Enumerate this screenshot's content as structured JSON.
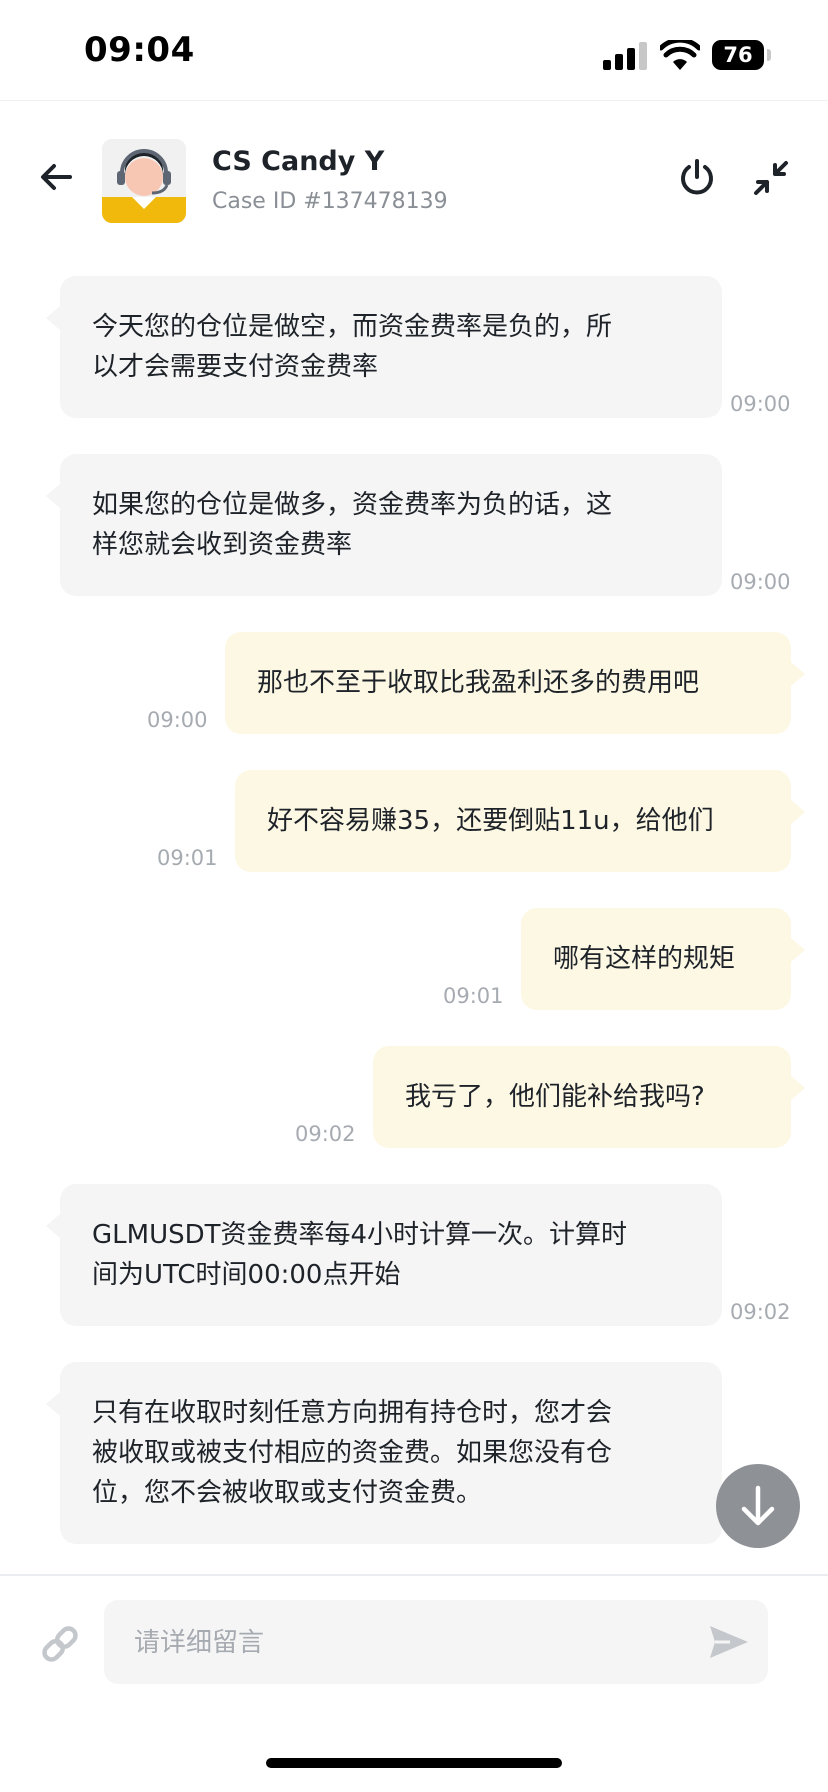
{
  "status_bar": {
    "time": "09:04",
    "battery": "76"
  },
  "header": {
    "agent_name": "CS Candy Y",
    "case_id": "Case ID #137478139"
  },
  "messages": [
    {
      "sender": "agent",
      "text": "今天您的仓位是做空，而资金费率是负的，所\n以才会需要支付资金费率",
      "time": "09:00"
    },
    {
      "sender": "agent",
      "text": "如果您的仓位是做多，资金费率为负的话，这\n样您就会收到资金费率",
      "time": "09:00"
    },
    {
      "sender": "user",
      "text": "那也不至于收取比我盈利还多的费用吧",
      "time": "09:00"
    },
    {
      "sender": "user",
      "text": "好不容易赚35，还要倒贴11u，给他们",
      "time": "09:01"
    },
    {
      "sender": "user",
      "text": "哪有这样的规矩",
      "time": "09:01"
    },
    {
      "sender": "user",
      "text": "我亏了，他们能补给我吗?",
      "time": "09:02"
    },
    {
      "sender": "agent",
      "text": "GLMUSDT资金费率每4小时计算一次。计算时\n间为UTC时间00:00点开始",
      "time": "09:02"
    },
    {
      "sender": "agent",
      "text": "只有在收取时刻任意方向拥有持仓时，您才会\n被收取或被支付相应的资金费。如果您没有仓\n位，您不会被收取或支付资金费。",
      "time": ""
    }
  ],
  "composer": {
    "placeholder": "请详细留言",
    "value": ""
  },
  "icons": {
    "back": "arrow-left-icon",
    "power": "power-icon",
    "minimize": "minimize-arrows-icon",
    "scroll_down": "arrow-down-icon",
    "attach": "link-icon",
    "send": "send-icon"
  },
  "colors": {
    "agent_bubble": "#f5f5f5",
    "user_bubble": "#fdf8e4",
    "brand_yellow": "#f0b90b",
    "timestamp": "#a6abb1"
  }
}
